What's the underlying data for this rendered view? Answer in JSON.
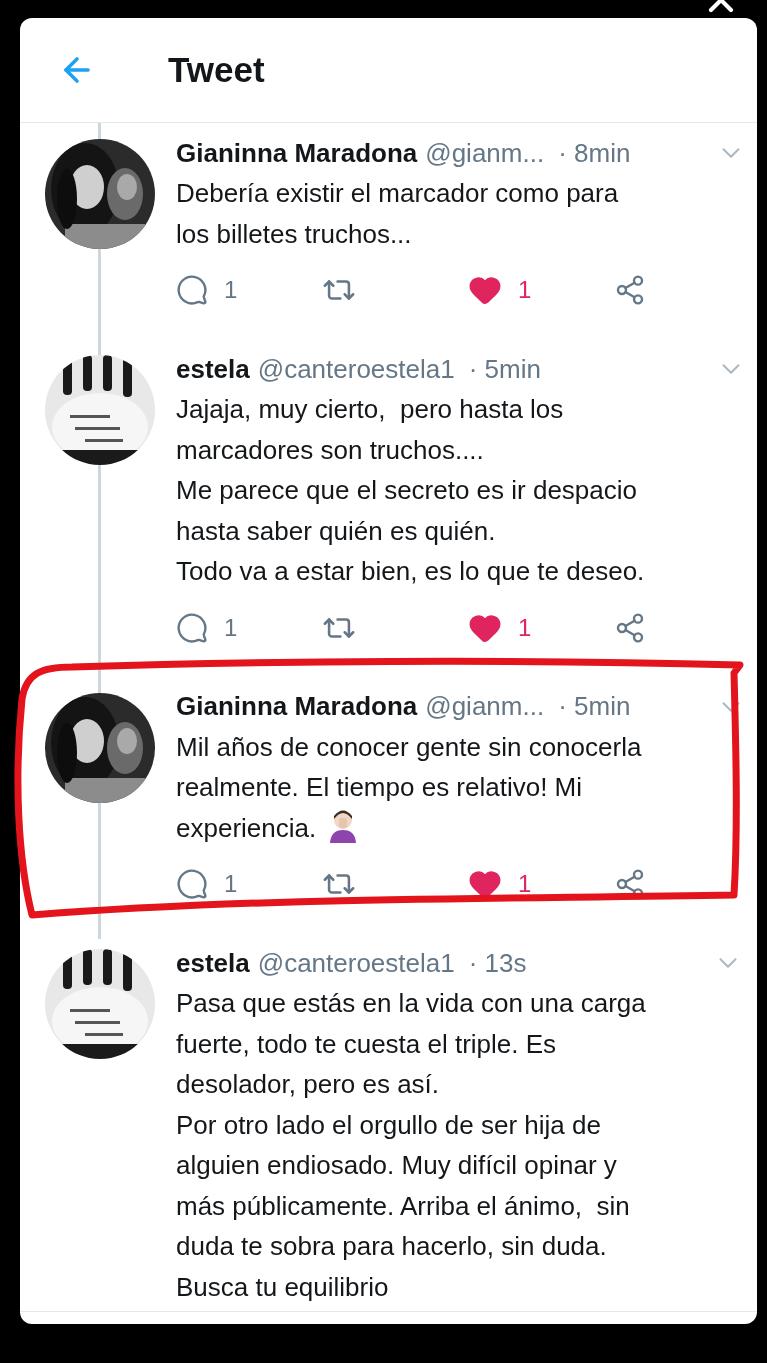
{
  "header": {
    "title": "Tweet"
  },
  "tweets": [
    {
      "name": "Gianinna Maradona",
      "handle": "@gianm...",
      "time": "· 8min",
      "lines": [
        "Debería existir el marcador como para",
        "los billetes truchos..."
      ],
      "actions": {
        "replies": "1",
        "likes": "1",
        "liked": true
      }
    },
    {
      "name": "estela",
      "handle": "@canteroestela1",
      "time": "· 5min",
      "lines": [
        "Jajaja, muy cierto,  pero hasta los",
        "marcadores son truchos....",
        "Me parece que el secreto es ir despacio",
        "hasta saber quién es quién.",
        "Todo va a estar bien, es lo que te deseo."
      ],
      "actions": {
        "replies": "1",
        "likes": "1",
        "liked": true
      }
    },
    {
      "name": "Gianinna Maradona",
      "handle": "@gianm...",
      "time": "· 5min",
      "lines": [
        "Mil años de conocer gente sin conocerla",
        "realmente. El tiempo es relativo! Mi",
        "experiencia."
      ],
      "trailing_emoji": true,
      "highlighted": true,
      "actions": {
        "replies": "1",
        "likes": "1",
        "liked": true
      }
    },
    {
      "name": "estela",
      "handle": "@canteroestela1",
      "time": "· 13s",
      "lines": [
        "Pasa que estás en la vida con una carga",
        "fuerte, todo te cuesta el triple. Es",
        "desolador, pero es así.",
        "Por otro lado el orgullo de ser hija de",
        "alguien endiosado. Muy difícil opinar y",
        "más públicamente. Arriba el ánimo,  sin",
        "duda te sobra para hacerlo, sin duda.",
        "Busca tu equilibrio"
      ]
    }
  ]
}
